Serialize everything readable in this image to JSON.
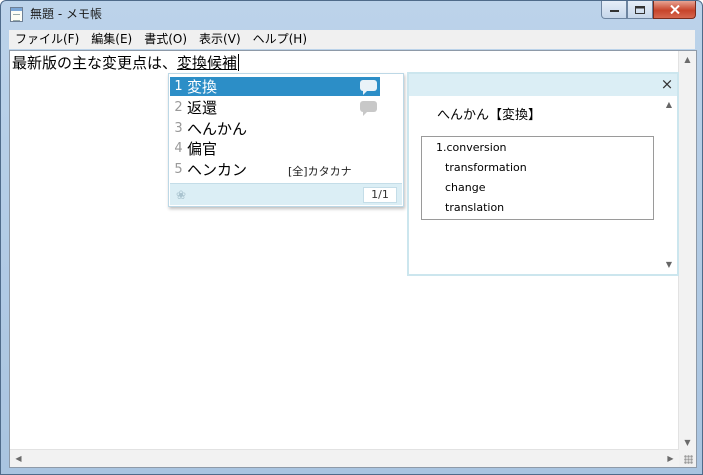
{
  "window": {
    "title": "無題 - メモ帳",
    "controls": {
      "minimize": "▭",
      "maximize": "□",
      "close": "✕"
    }
  },
  "menu": {
    "items": [
      "ファイル(F)",
      "編集(E)",
      "書式(O)",
      "表示(V)",
      "ヘルプ(H)"
    ]
  },
  "editor": {
    "committed_text": "最新版の主な変更点は、",
    "composing_text": "変換候補"
  },
  "ime": {
    "candidates": [
      {
        "num": "1",
        "word": "変換",
        "selected": true,
        "has_bubble": true
      },
      {
        "num": "2",
        "word": "返還",
        "selected": false,
        "has_bubble": true
      },
      {
        "num": "3",
        "word": "へんかん",
        "selected": false,
        "has_bubble": false
      },
      {
        "num": "4",
        "word": "偏官",
        "selected": false,
        "has_bubble": false
      },
      {
        "num": "5",
        "word": "ヘンカン",
        "selected": false,
        "has_bubble": false,
        "note": "[全]カタカナ"
      }
    ],
    "page_indicator": "1/1",
    "footer_icon": "paw-icon"
  },
  "dictionary": {
    "headword": "へんかん【変換】",
    "close_label": "×",
    "entries": [
      {
        "text": "1.conversion",
        "indent": false
      },
      {
        "text": "transformation",
        "indent": true
      },
      {
        "text": "change",
        "indent": true
      },
      {
        "text": "translation",
        "indent": true
      }
    ]
  },
  "colors": {
    "selection": "#2c8ec7",
    "ime_panel": "#dbeef5",
    "frame": "#bcd3ea"
  }
}
